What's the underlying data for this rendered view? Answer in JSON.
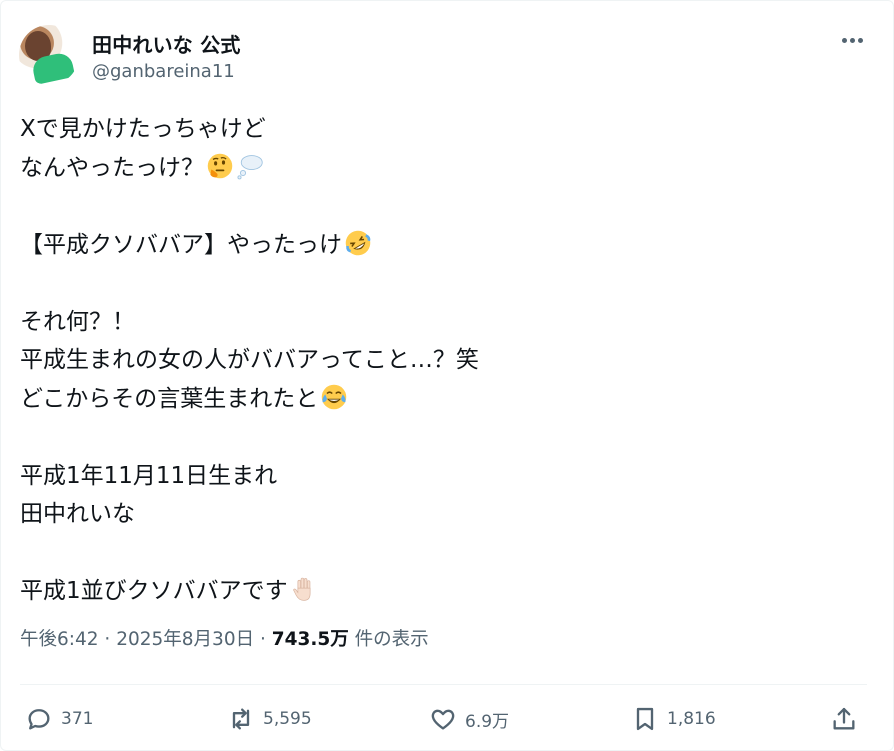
{
  "author": {
    "display_name": "田中れいな 公式",
    "handle": "@ganbareina11"
  },
  "post": {
    "lines": [
      {
        "text": "Xで見かけたっちゃけど",
        "emoji": []
      },
      {
        "text": "なんやったっけ？",
        "emoji": [
          "thinking-face",
          "thought-balloon"
        ]
      },
      {
        "text": "",
        "emoji": []
      },
      {
        "text": "【平成クソババア】やったっけ",
        "emoji": [
          "rolling-on-floor-laughing"
        ]
      },
      {
        "text": "",
        "emoji": []
      },
      {
        "text": "それ何？！",
        "emoji": []
      },
      {
        "text": "平成生まれの女の人がババアってこと…？笑",
        "emoji": []
      },
      {
        "text": "どこからその言葉生まれたと",
        "emoji": [
          "face-with-tears-of-joy"
        ]
      },
      {
        "text": "",
        "emoji": []
      },
      {
        "text": "平成1年11月11日生まれ",
        "emoji": []
      },
      {
        "text": "田中れいな",
        "emoji": []
      },
      {
        "text": "",
        "emoji": []
      },
      {
        "text": "平成1並びクソババアです",
        "emoji": [
          "raised-hand"
        ]
      }
    ]
  },
  "meta": {
    "time": "午後6:42",
    "sep1": " · ",
    "date": "2025年8月30日",
    "sep2": " · ",
    "views": "743.5万",
    "views_label": " 件の表示"
  },
  "actions": {
    "replies": "371",
    "reposts": "5,595",
    "likes": "6.9万",
    "bookmarks": "1,816"
  },
  "colors": {
    "text": "#0f1419",
    "secondary": "#536471",
    "divider": "#eff3f4"
  }
}
